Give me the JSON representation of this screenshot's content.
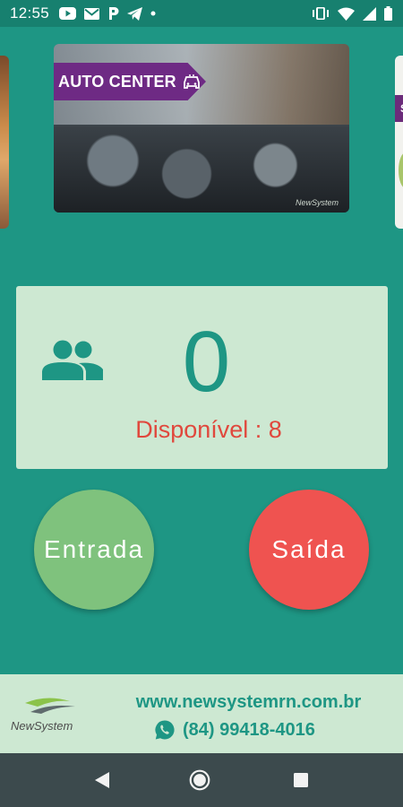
{
  "status_bar": {
    "time": "12:55",
    "left_icons": [
      "youtube-icon",
      "gmail-icon",
      "parking-icon",
      "telegram-icon",
      "dot-icon"
    ],
    "right_icons": [
      "vibrate-icon",
      "wifi-icon",
      "signal-icon",
      "battery-icon"
    ]
  },
  "carousel": {
    "banner_text": "AUTO CENTER",
    "banner_brand": "NewSystem",
    "next_banner_text": "S"
  },
  "counter": {
    "count": "0",
    "available_text": "Disponível : 8",
    "icon": "people-icon"
  },
  "actions": {
    "entrada_label": "Entrada",
    "saida_label": "Saída"
  },
  "footer": {
    "logo_text": "NewSystem",
    "website": "www.newsystemrn.com.br",
    "phone": "(84) 99418-4016"
  },
  "nav": {
    "icons": [
      "back-icon",
      "home-icon",
      "recent-apps-icon"
    ]
  },
  "colors": {
    "background": "#1e9684",
    "card": "#cde8d2",
    "entrada": "#7fc27d",
    "saida": "#ef5350",
    "available": "#e0483d",
    "banner_tag": "#6e2a84"
  }
}
